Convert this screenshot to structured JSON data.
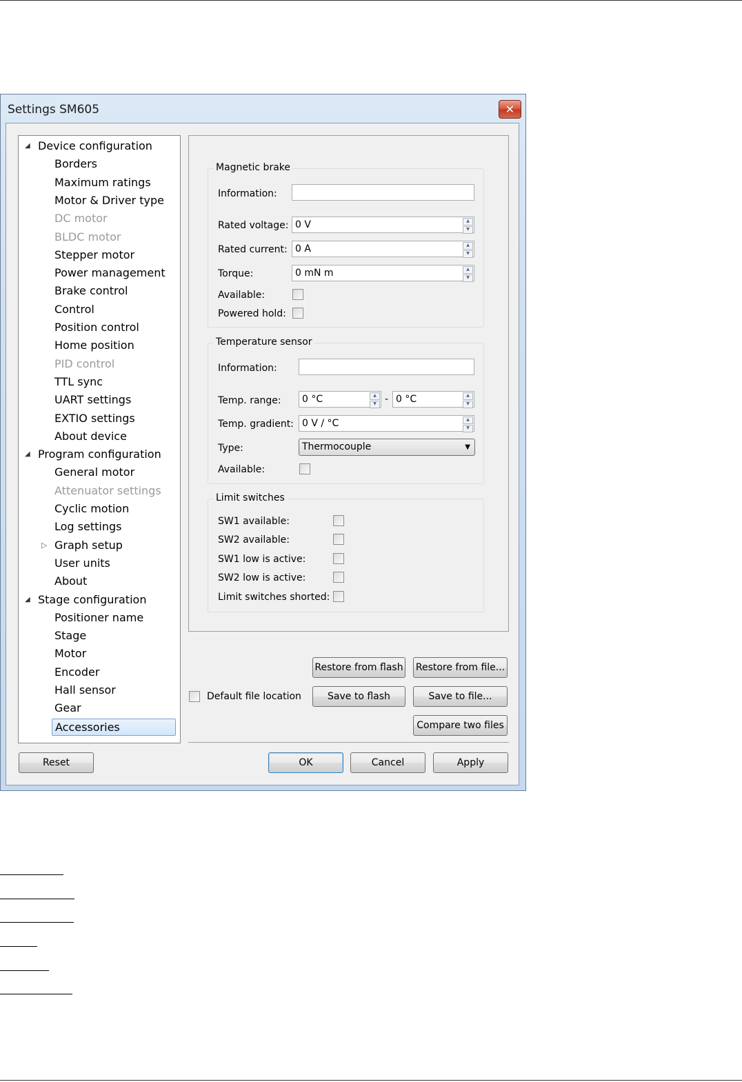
{
  "window": {
    "title": "Settings SM605",
    "close_glyph": "✕"
  },
  "tree": [
    {
      "label": "Device configuration",
      "level": 0,
      "expanded": true
    },
    {
      "label": "Borders",
      "level": 1
    },
    {
      "label": "Maximum ratings",
      "level": 1
    },
    {
      "label": "Motor & Driver type",
      "level": 1
    },
    {
      "label": "DC motor",
      "level": 1,
      "disabled": true
    },
    {
      "label": "BLDC motor",
      "level": 1,
      "disabled": true
    },
    {
      "label": "Stepper motor",
      "level": 1
    },
    {
      "label": "Power management",
      "level": 1
    },
    {
      "label": "Brake control",
      "level": 1
    },
    {
      "label": "Control",
      "level": 1
    },
    {
      "label": "Position control",
      "level": 1
    },
    {
      "label": "Home position",
      "level": 1
    },
    {
      "label": "PID control",
      "level": 1,
      "disabled": true
    },
    {
      "label": "TTL sync",
      "level": 1
    },
    {
      "label": "UART settings",
      "level": 1
    },
    {
      "label": "EXTIO settings",
      "level": 1
    },
    {
      "label": "About device",
      "level": 1
    },
    {
      "label": "Program configuration",
      "level": 0,
      "expanded": true
    },
    {
      "label": "General motor",
      "level": 1
    },
    {
      "label": "Attenuator settings",
      "level": 1,
      "disabled": true
    },
    {
      "label": "Cyclic motion",
      "level": 1
    },
    {
      "label": "Log settings",
      "level": 1
    },
    {
      "label": "Graph setup",
      "level": 1,
      "collapsed": true
    },
    {
      "label": "User units",
      "level": 1
    },
    {
      "label": "About",
      "level": 1
    },
    {
      "label": "Stage configuration",
      "level": 0,
      "expanded": true
    },
    {
      "label": "Positioner name",
      "level": 1
    },
    {
      "label": "Stage",
      "level": 1
    },
    {
      "label": "Motor",
      "level": 1
    },
    {
      "label": "Encoder",
      "level": 1
    },
    {
      "label": "Hall sensor",
      "level": 1
    },
    {
      "label": "Gear",
      "level": 1
    },
    {
      "label": "Accessories",
      "level": 1,
      "selected": true
    }
  ],
  "magnetic_brake": {
    "title": "Magnetic brake",
    "information_label": "Information:",
    "information_value": "",
    "rated_voltage_label": "Rated voltage:",
    "rated_voltage_value": "0 V",
    "rated_current_label": "Rated current:",
    "rated_current_value": "0 A",
    "torque_label": "Torque:",
    "torque_value": "0 mN m",
    "available_label": "Available:",
    "powered_hold_label": "Powered hold:"
  },
  "temperature_sensor": {
    "title": "Temperature sensor",
    "information_label": "Information:",
    "information_value": "",
    "temp_range_label": "Temp. range:",
    "temp_range_from": "0 °C",
    "temp_range_sep": "-",
    "temp_range_to": "0 °C",
    "temp_gradient_label": "Temp. gradient:",
    "temp_gradient_value": "0 V / °C",
    "type_label": "Type:",
    "type_value": "Thermocouple",
    "available_label": "Available:"
  },
  "limit_switches": {
    "title": "Limit switches",
    "sw1_available": "SW1 available:",
    "sw2_available": "SW2 available:",
    "sw1_low_active": "SW1 low is active:",
    "sw2_low_active": "SW2 low is active:",
    "shorted": "Limit switches shorted:"
  },
  "file_ops": {
    "restore_flash": "Restore from flash",
    "restore_file": "Restore from file...",
    "default_location": "Default file location",
    "save_flash": "Save to flash",
    "save_file": "Save to file...",
    "compare": "Compare two files"
  },
  "footer": {
    "reset": "Reset",
    "ok": "OK",
    "cancel": "Cancel",
    "apply": "Apply"
  }
}
